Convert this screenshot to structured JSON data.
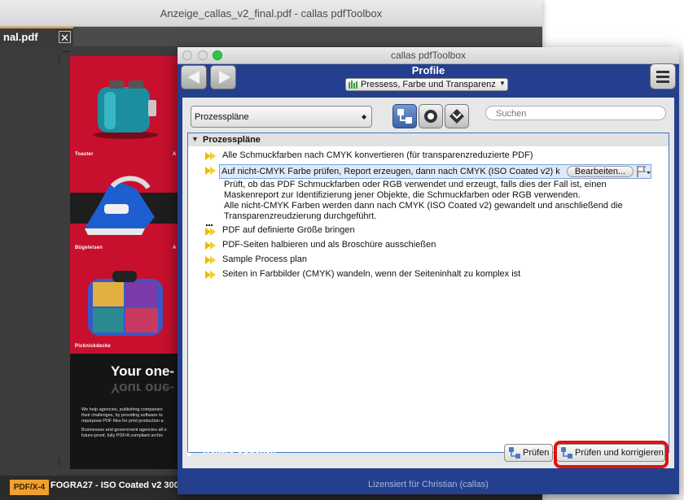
{
  "bg_window": {
    "title": "Anzeige_callas_v2_final.pdf - callas pdfToolbox",
    "tab_label": "nal.pdf",
    "tab_close": "✕",
    "page": {
      "captions": [
        "Toaster",
        "Bügeleisen",
        "Picknickdecke"
      ],
      "caption_right": [
        "A",
        "A"
      ],
      "headline": "Your one-",
      "headline_reflection": "Your one-",
      "para1": [
        "We help agencies, publishing companies",
        "their challenges, by providing software to",
        "repurpose PDF files for print production a"
      ],
      "para2": [
        "Businesses and government agencies all o",
        "future-proof, fully PDF/A compliant archiv"
      ]
    },
    "status": {
      "badge": "PDF/X-4",
      "profile": "FOGRA27 - ISO Coated v2 300"
    }
  },
  "fg_window": {
    "title": "callas pdfToolbox",
    "header_title": "Profile",
    "profile_select": "Pressess, Farbe und Transparenz",
    "category_select": "Prozesspläne",
    "search_placeholder": "Suchen",
    "group": "Prozesspläne",
    "items": [
      "Alle Schmuckfarben nach CMYK konvertieren (für transparenzreduzierte PDF)",
      "Auf nicht-CMYK Farbe prüfen, Report erzeugen, dann nach CMYK (ISO Coated v2) k",
      "PDF auf definierte Größe bringen",
      "PDF-Seiten halbieren und als Broschüre ausschießen",
      "Sample Process plan",
      "Seiten in Farbbilder (CMYK) wandeln, wenn der Seiteninhalt zu komplex ist"
    ],
    "edit_button": "Bearbeiten...",
    "description": [
      "Prüft, ob das PDF Schmuckfarben oder RGB verwendet und erzeugt, falls dies der Fall ist, einen",
      "Maskenreport zur Identifizierung jener Objekte, die Schmuckfarben oder RGB verwenden.",
      "Alle nicht-CMYK Farben werden dann nach CMYK (ISO Coated v2) gewandelt und anschließend die",
      "Transparenzreudzierung durchgeführt."
    ],
    "more_options": "Weitere Optionen",
    "check_button": "Prüfen",
    "fix_button": "Prüfen und korrigieren",
    "license": "Lizensiert für Christian (callas)"
  },
  "colors": {
    "panel_blue": "#243f8e",
    "accent_orange": "#f0a030",
    "highlight_red": "#e0120e",
    "selection_border": "#7aa3dc"
  }
}
